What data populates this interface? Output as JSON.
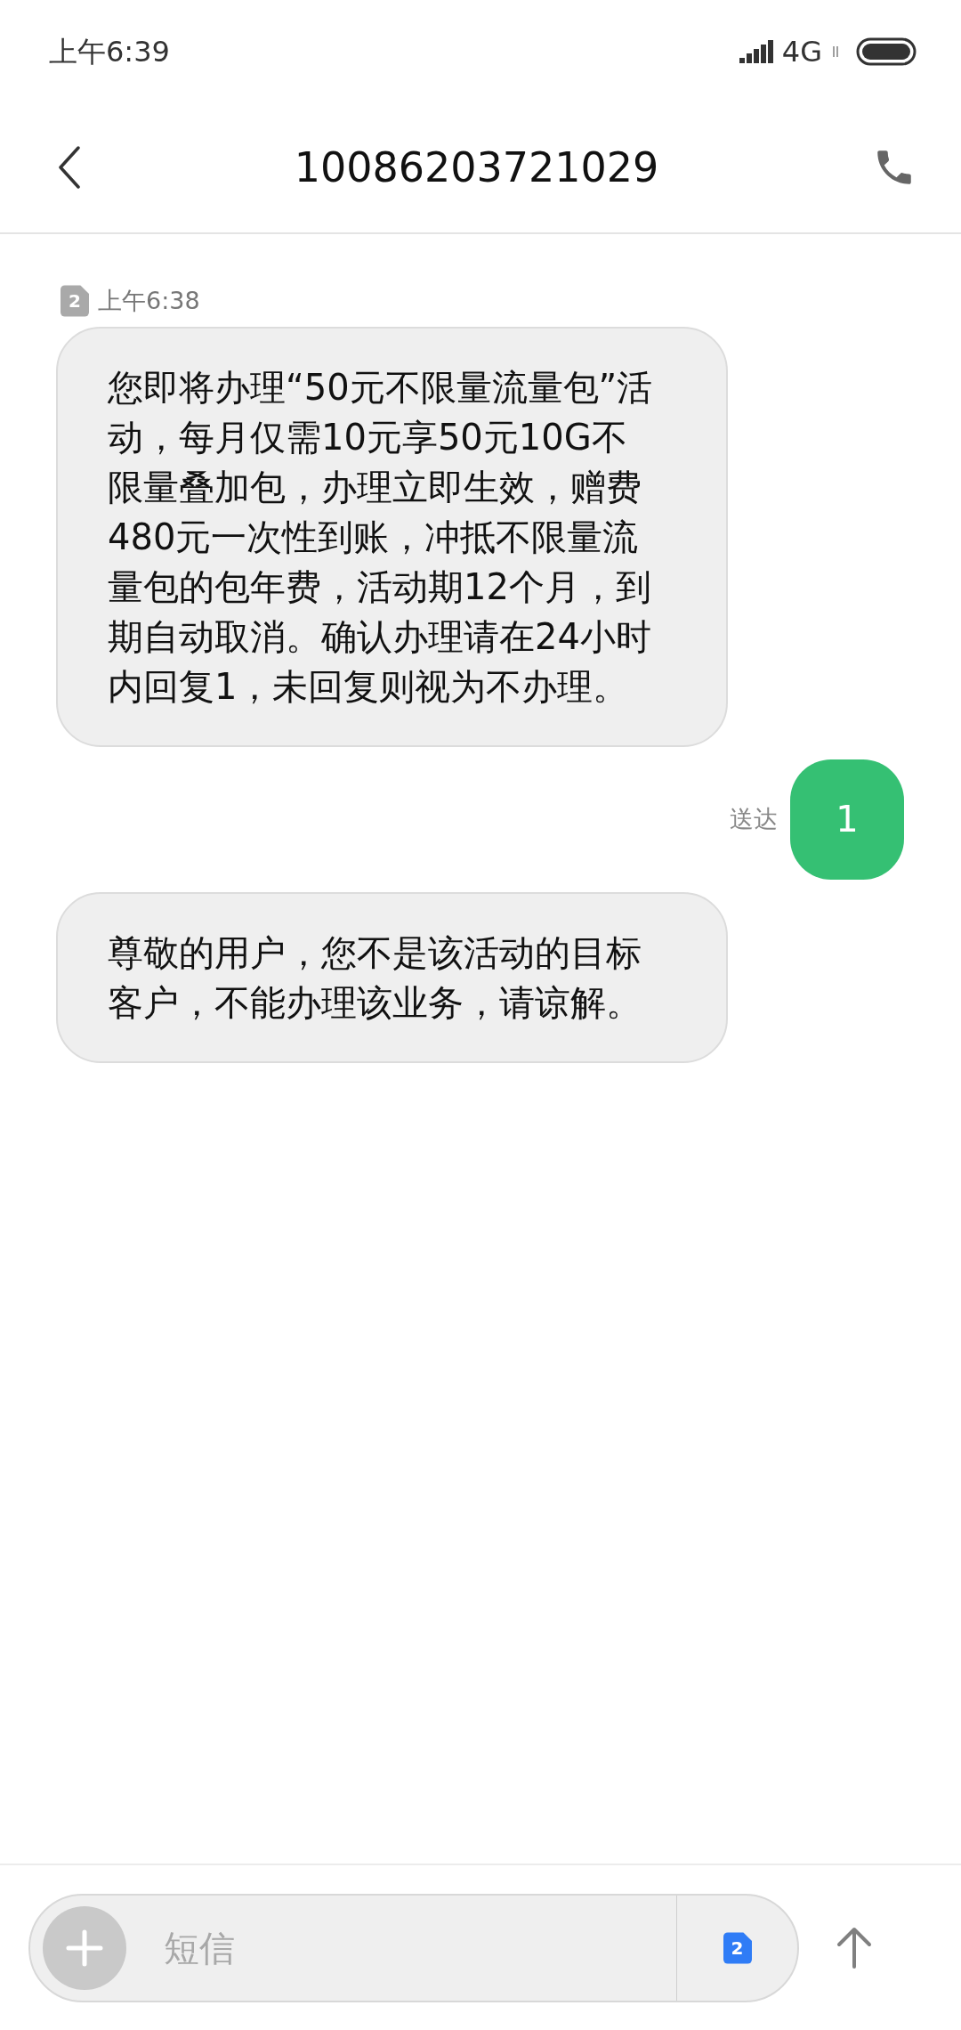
{
  "status_bar": {
    "time": "上午6:39",
    "network": "4G"
  },
  "header": {
    "title": "10086203721029"
  },
  "messages": [
    {
      "kind": "received",
      "sim": "2",
      "time": "上午6:38",
      "text": "您即将办理“50元不限量流量包”活动，每月仅需10元享50元10G不限量叠加包，办理立即生效，赠费480元一次性到账，冲抵不限量流量包的包年费，活动期12个月，到期自动取消。确认办理请在24小时内回复1，未回复则视为不办理。"
    },
    {
      "kind": "sent",
      "status": "送达",
      "text": "1"
    },
    {
      "kind": "received",
      "text": "尊敬的用户，您不是该活动的目标客户，不能办理该业务，请谅解。"
    }
  ],
  "composer": {
    "placeholder": "短信",
    "sim": "2"
  }
}
